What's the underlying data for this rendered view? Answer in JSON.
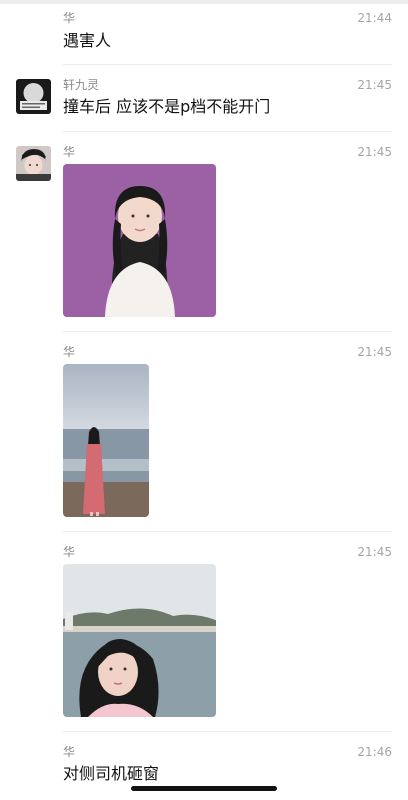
{
  "messages": [
    {
      "sender": "华",
      "time": "21:44",
      "text": "遇害人"
    },
    {
      "sender": "轩九灵",
      "time": "21:45",
      "text": "撞车后 应该不是p档不能开门"
    },
    {
      "sender": "华",
      "time": "21:45",
      "image": "photo-girl-purple-background"
    },
    {
      "sender": "华",
      "time": "21:45",
      "image": "photo-girl-beach-pink-dress"
    },
    {
      "sender": "华",
      "time": "21:45",
      "image": "photo-girl-seaside-portrait"
    },
    {
      "sender": "华",
      "time": "21:46",
      "text": "对侧司机砸窗"
    }
  ],
  "colors": {
    "sender": "#8a8a8a",
    "time": "#a6a6a6",
    "text": "#111111",
    "divider": "#ececec"
  }
}
